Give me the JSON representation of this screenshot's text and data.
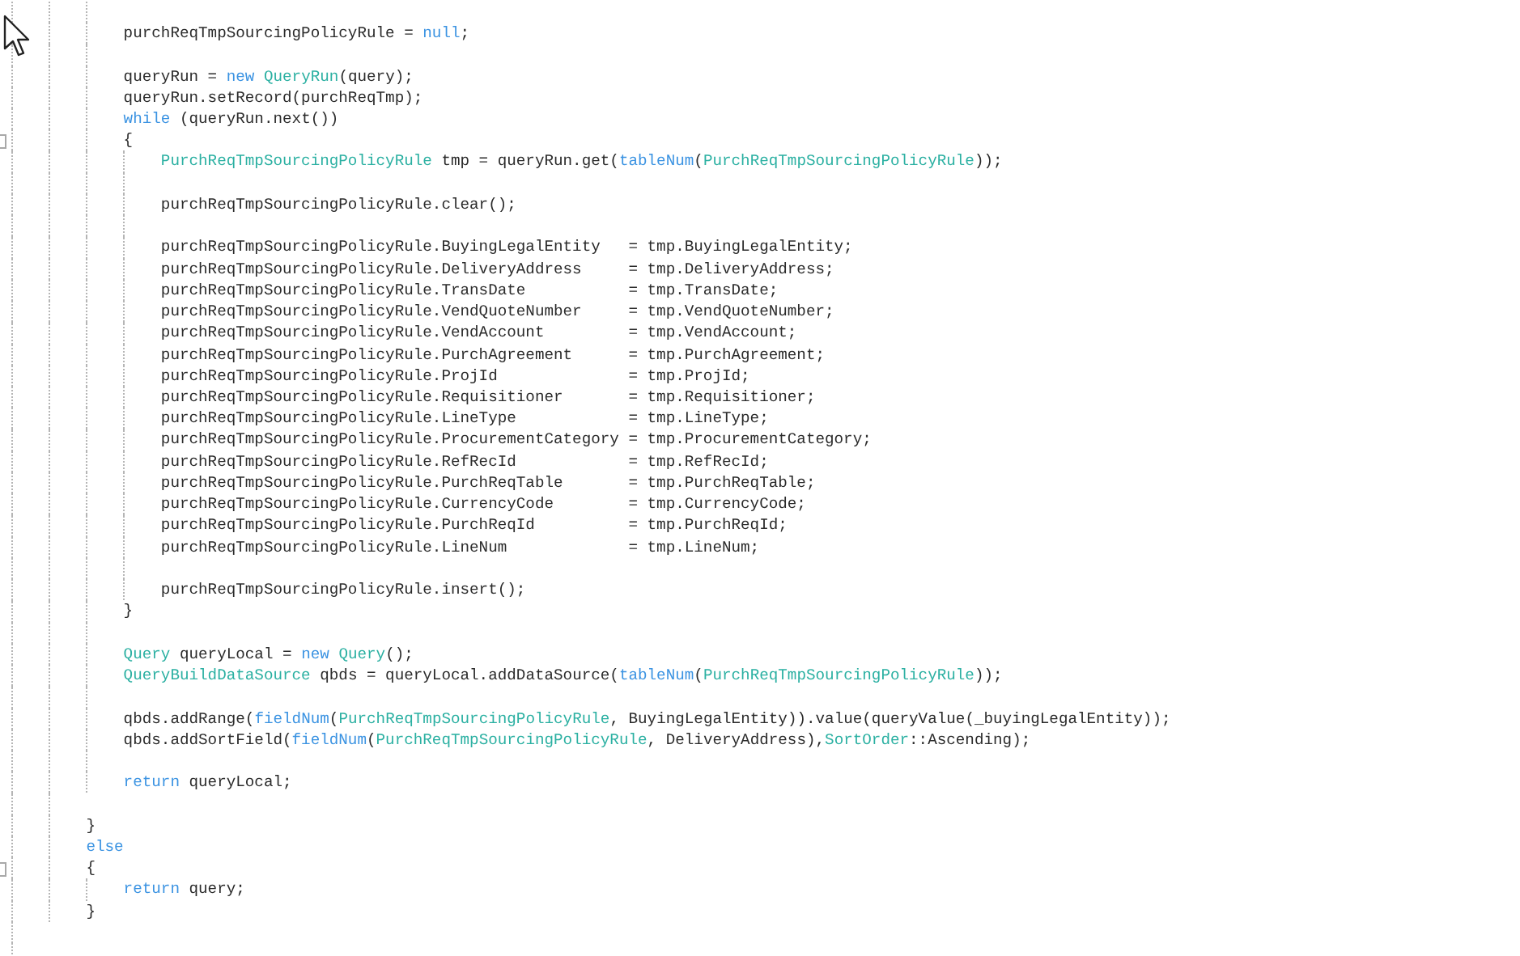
{
  "editor": {
    "lines": [
      {
        "kind": "blank"
      },
      {
        "kind": "code",
        "segments": [
          {
            "text": "            purchReqTmpSourcingPolicyRule = ",
            "kind": "plain"
          },
          {
            "text": "null",
            "kind": "keyword"
          },
          {
            "text": ";",
            "kind": "plain"
          }
        ]
      },
      {
        "kind": "blank"
      },
      {
        "kind": "code",
        "segments": [
          {
            "text": "            queryRun = ",
            "kind": "plain"
          },
          {
            "text": "new ",
            "kind": "keyword"
          },
          {
            "text": "QueryRun",
            "kind": "type"
          },
          {
            "text": "(query);",
            "kind": "plain"
          }
        ]
      },
      {
        "kind": "code",
        "segments": [
          {
            "text": "            queryRun.setRecord(purchReqTmp);",
            "kind": "plain"
          }
        ]
      },
      {
        "kind": "code",
        "segments": [
          {
            "text": "            while",
            "kind": "keyword"
          },
          {
            "text": " (queryRun.next())",
            "kind": "plain"
          }
        ]
      },
      {
        "kind": "code",
        "fold_marker": true,
        "segments": [
          {
            "text": "            {",
            "kind": "plain"
          }
        ]
      },
      {
        "kind": "code",
        "segments": [
          {
            "text": "                PurchReqTmpSourcingPolicyRule",
            "kind": "type"
          },
          {
            "text": " tmp = queryRun.get(",
            "kind": "plain"
          },
          {
            "text": "tableNum",
            "kind": "keyword"
          },
          {
            "text": "(",
            "kind": "plain"
          },
          {
            "text": "PurchReqTmpSourcingPolicyRule",
            "kind": "type"
          },
          {
            "text": "));",
            "kind": "plain"
          }
        ]
      },
      {
        "kind": "blank"
      },
      {
        "kind": "code",
        "segments": [
          {
            "text": "                purchReqTmpSourcingPolicyRule.clear();",
            "kind": "plain"
          }
        ]
      },
      {
        "kind": "blank"
      },
      {
        "kind": "code",
        "segments": [
          {
            "text": "                purchReqTmpSourcingPolicyRule.BuyingLegalEntity   = tmp.BuyingLegalEntity;",
            "kind": "plain"
          }
        ]
      },
      {
        "kind": "code",
        "segments": [
          {
            "text": "                purchReqTmpSourcingPolicyRule.DeliveryAddress     = tmp.DeliveryAddress;",
            "kind": "plain"
          }
        ]
      },
      {
        "kind": "code",
        "segments": [
          {
            "text": "                purchReqTmpSourcingPolicyRule.TransDate           = tmp.TransDate;",
            "kind": "plain"
          }
        ]
      },
      {
        "kind": "code",
        "segments": [
          {
            "text": "                purchReqTmpSourcingPolicyRule.VendQuoteNumber     = tmp.VendQuoteNumber;",
            "kind": "plain"
          }
        ]
      },
      {
        "kind": "code",
        "segments": [
          {
            "text": "                purchReqTmpSourcingPolicyRule.VendAccount         = tmp.VendAccount;",
            "kind": "plain"
          }
        ]
      },
      {
        "kind": "code",
        "segments": [
          {
            "text": "                purchReqTmpSourcingPolicyRule.PurchAgreement      = tmp.PurchAgreement;",
            "kind": "plain"
          }
        ]
      },
      {
        "kind": "code",
        "segments": [
          {
            "text": "                purchReqTmpSourcingPolicyRule.ProjId              = tmp.ProjId;",
            "kind": "plain"
          }
        ]
      },
      {
        "kind": "code",
        "segments": [
          {
            "text": "                purchReqTmpSourcingPolicyRule.Requisitioner       = tmp.Requisitioner;",
            "kind": "plain"
          }
        ]
      },
      {
        "kind": "code",
        "segments": [
          {
            "text": "                purchReqTmpSourcingPolicyRule.LineType            = tmp.LineType;",
            "kind": "plain"
          }
        ]
      },
      {
        "kind": "code",
        "segments": [
          {
            "text": "                purchReqTmpSourcingPolicyRule.ProcurementCategory = tmp.ProcurementCategory;",
            "kind": "plain"
          }
        ]
      },
      {
        "kind": "code",
        "segments": [
          {
            "text": "                purchReqTmpSourcingPolicyRule.RefRecId            = tmp.RefRecId;",
            "kind": "plain"
          }
        ]
      },
      {
        "kind": "code",
        "segments": [
          {
            "text": "                purchReqTmpSourcingPolicyRule.PurchReqTable       = tmp.PurchReqTable;",
            "kind": "plain"
          }
        ]
      },
      {
        "kind": "code",
        "segments": [
          {
            "text": "                purchReqTmpSourcingPolicyRule.CurrencyCode        = tmp.CurrencyCode;",
            "kind": "plain"
          }
        ]
      },
      {
        "kind": "code",
        "segments": [
          {
            "text": "                purchReqTmpSourcingPolicyRule.PurchReqId          = tmp.PurchReqId;",
            "kind": "plain"
          }
        ]
      },
      {
        "kind": "code",
        "segments": [
          {
            "text": "                purchReqTmpSourcingPolicyRule.LineNum             = tmp.LineNum;",
            "kind": "plain"
          }
        ]
      },
      {
        "kind": "blank"
      },
      {
        "kind": "code",
        "segments": [
          {
            "text": "                purchReqTmpSourcingPolicyRule.insert();",
            "kind": "plain"
          }
        ]
      },
      {
        "kind": "code",
        "segments": [
          {
            "text": "            }",
            "kind": "plain"
          }
        ]
      },
      {
        "kind": "blank"
      },
      {
        "kind": "code",
        "segments": [
          {
            "text": "            Query",
            "kind": "type"
          },
          {
            "text": " queryLocal = ",
            "kind": "plain"
          },
          {
            "text": "new ",
            "kind": "keyword"
          },
          {
            "text": "Query",
            "kind": "type"
          },
          {
            "text": "();",
            "kind": "plain"
          }
        ]
      },
      {
        "kind": "code",
        "segments": [
          {
            "text": "            QueryBuildDataSource",
            "kind": "type"
          },
          {
            "text": " qbds = queryLocal.addDataSource(",
            "kind": "plain"
          },
          {
            "text": "tableNum",
            "kind": "keyword"
          },
          {
            "text": "(",
            "kind": "plain"
          },
          {
            "text": "PurchReqTmpSourcingPolicyRule",
            "kind": "type"
          },
          {
            "text": "));",
            "kind": "plain"
          }
        ]
      },
      {
        "kind": "blank"
      },
      {
        "kind": "code",
        "segments": [
          {
            "text": "            qbds.addRange(",
            "kind": "plain"
          },
          {
            "text": "fieldNum",
            "kind": "keyword"
          },
          {
            "text": "(",
            "kind": "plain"
          },
          {
            "text": "PurchReqTmpSourcingPolicyRule",
            "kind": "type"
          },
          {
            "text": ", BuyingLegalEntity)).value(queryValue(_buyingLegalEntity));",
            "kind": "plain"
          }
        ]
      },
      {
        "kind": "code",
        "segments": [
          {
            "text": "            qbds.addSortField(",
            "kind": "plain"
          },
          {
            "text": "fieldNum",
            "kind": "keyword"
          },
          {
            "text": "(",
            "kind": "plain"
          },
          {
            "text": "PurchReqTmpSourcingPolicyRule",
            "kind": "type"
          },
          {
            "text": ", DeliveryAddress),",
            "kind": "plain"
          },
          {
            "text": "SortOrder",
            "kind": "type"
          },
          {
            "text": "::Ascending);",
            "kind": "plain"
          }
        ]
      },
      {
        "kind": "blank"
      },
      {
        "kind": "code",
        "segments": [
          {
            "text": "            return",
            "kind": "keyword"
          },
          {
            "text": " queryLocal;",
            "kind": "plain"
          }
        ]
      },
      {
        "kind": "blank"
      },
      {
        "kind": "code",
        "segments": [
          {
            "text": "        }",
            "kind": "plain"
          }
        ]
      },
      {
        "kind": "code",
        "segments": [
          {
            "text": "        else",
            "kind": "keyword"
          }
        ]
      },
      {
        "kind": "code",
        "fold_marker": true,
        "segments": [
          {
            "text": "        {",
            "kind": "plain"
          }
        ]
      },
      {
        "kind": "code",
        "segments": [
          {
            "text": "            return",
            "kind": "keyword"
          },
          {
            "text": " query;",
            "kind": "plain"
          }
        ]
      },
      {
        "kind": "code",
        "segments": [
          {
            "text": "        }",
            "kind": "plain"
          }
        ]
      },
      {
        "kind": "blank"
      },
      {
        "kind": "blank"
      }
    ]
  }
}
